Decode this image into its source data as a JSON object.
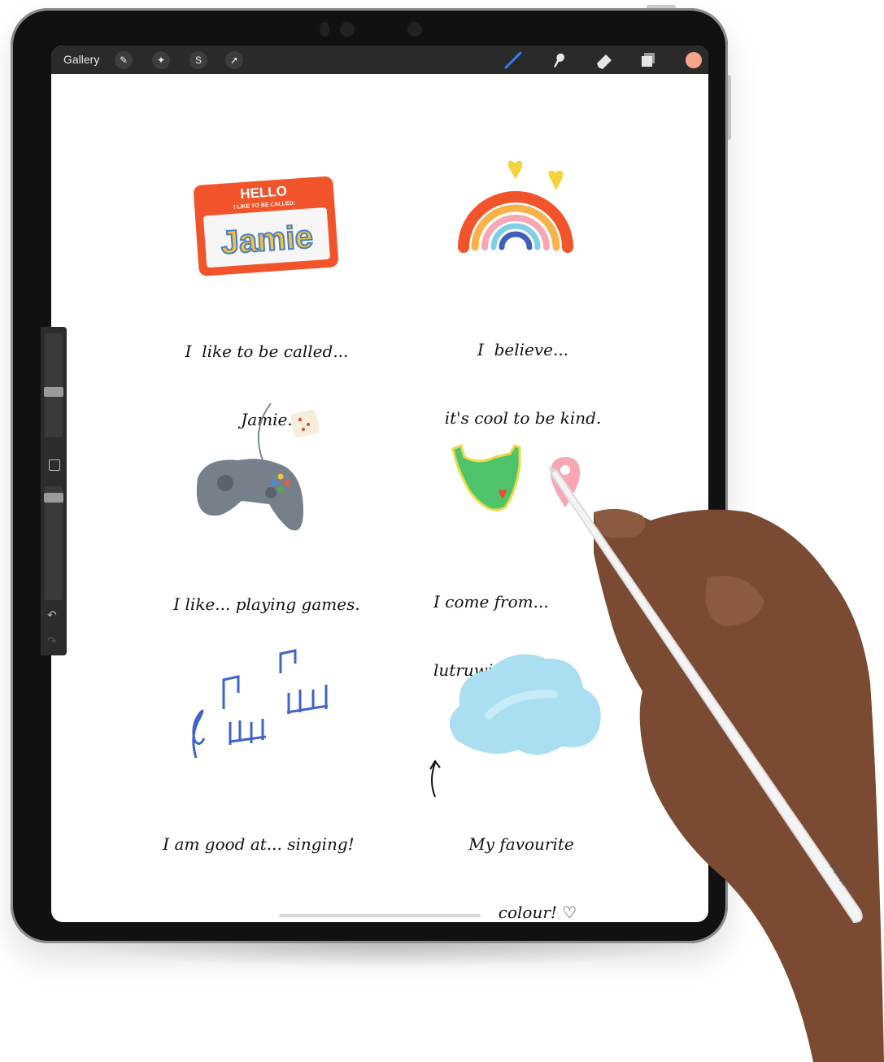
{
  "toolbar": {
    "gallery_label": "Gallery",
    "left_icons": [
      "wrench-icon",
      "magic-wand-icon",
      "selection-icon",
      "arrow-transform-icon"
    ],
    "right_icons": [
      "brush-icon",
      "smudge-icon",
      "eraser-icon",
      "layers-icon"
    ],
    "current_color": "#f7a58a"
  },
  "canvas": {
    "cards": [
      {
        "sticker": "name-tag-sticker",
        "tag_title": "HELLO",
        "tag_sub": "I LIKE TO BE CALLED:",
        "tag_name": "Jamie",
        "caption_line1": "I  like to be called...",
        "caption_line2": "Jamie."
      },
      {
        "sticker": "rainbow-sticker",
        "caption_line1": "I  believe...",
        "caption_line2": "it's cool to be kind."
      },
      {
        "sticker": "game-controller-sticker",
        "caption_line1": "I like... playing games."
      },
      {
        "sticker": "map-pin-sticker",
        "caption_line1": "I come from...",
        "caption_line2": "lutruwita / Tasm"
      },
      {
        "sticker": "music-notes-sticker",
        "caption_line1": "I am good at... singing!"
      },
      {
        "sticker": "paint-blob-sticker",
        "caption_line1": "My favourite",
        "caption_line2": "colour! ♡"
      }
    ]
  },
  "pencil": {
    "label": "Pencil"
  }
}
